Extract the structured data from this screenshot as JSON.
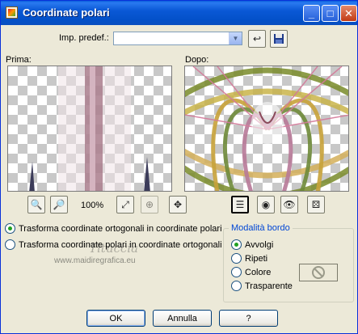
{
  "window": {
    "title": "Coordinate polari"
  },
  "titlebar_buttons": {
    "minimize_glyph": "_",
    "maximize_glyph": "□",
    "close_glyph": "✕"
  },
  "preset": {
    "label": "Imp. predef.:",
    "value": ""
  },
  "previews": {
    "before_label": "Prima:",
    "after_label": "Dopo:"
  },
  "zoom": {
    "level": "100%"
  },
  "transform_options": [
    {
      "label": "Trasforma coordinate ortogonali in coordinate polari",
      "selected": true
    },
    {
      "label": "Trasforma coordinate polari in coordinate ortogonali",
      "selected": false
    }
  ],
  "edge_mode": {
    "title": "Modalità bordo",
    "options": [
      {
        "label": "Avvolgi",
        "selected": true
      },
      {
        "label": "Ripeti",
        "selected": false
      },
      {
        "label": "Colore",
        "selected": false
      },
      {
        "label": "Trasparente",
        "selected": false
      }
    ]
  },
  "buttons": {
    "ok": "OK",
    "cancel": "Annulla",
    "help": "?"
  },
  "watermark": {
    "name": "Tituccia",
    "url": "www.maidiregrafica.eu"
  },
  "colors": {
    "titlebar": "#0a58d6",
    "dialog_bg": "#ece9d8",
    "group_title": "#0046d5",
    "radio_dot": "#21a121"
  }
}
